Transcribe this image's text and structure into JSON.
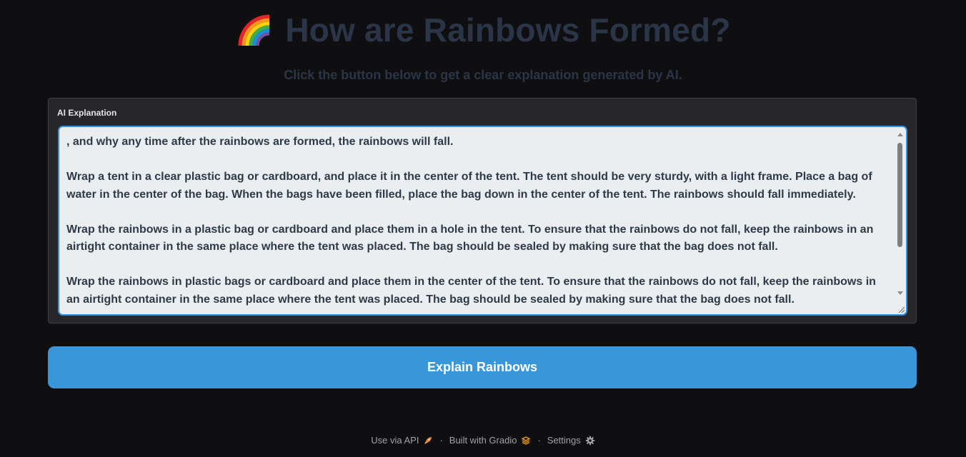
{
  "header": {
    "title": "How are Rainbows Formed?",
    "subtitle": "Click the button below to get a clear explanation generated by AI.",
    "icon": "rainbow-icon"
  },
  "output": {
    "label": "AI Explanation",
    "paragraphs": [
      ", and why any time after the rainbows are formed, the rainbows will fall.",
      "Wrap a tent in a clear plastic bag or cardboard, and place it in the center of the tent. The tent should be very sturdy, with a light frame. Place a bag of water in the center of the bag. When the bags have been filled, place the bag down in the center of the tent. The rainbows should fall immediately.",
      "Wrap the rainbows in a plastic bag or cardboard and place them in a hole in the tent. To ensure that the rainbows do not fall, keep the rainbows in an airtight container in the same place where the tent was placed. The bag should be sealed by making sure that the bag does not fall.",
      "Wrap the rainbows in plastic bags or cardboard and place them in the center of the tent. To ensure that the rainbows do not fall, keep the rainbows in an airtight container in the same place where the tent was placed. The bag should be sealed by making sure that the bag does not fall."
    ]
  },
  "button": {
    "label": "Explain Rainbows"
  },
  "footer": {
    "api_label": "Use via API",
    "api_icon": "rocket-icon",
    "separator": "·",
    "built_label": "Built with Gradio",
    "built_icon": "gradio-logo-icon",
    "settings_label": "Settings",
    "settings_icon": "gear-icon"
  },
  "colors": {
    "background": "#0f0f11",
    "title": "#2b3548",
    "panel": "#27272a",
    "textbox": "#ebeef0",
    "accent": "#3896d9",
    "footer_text": "#a1a1aa"
  }
}
